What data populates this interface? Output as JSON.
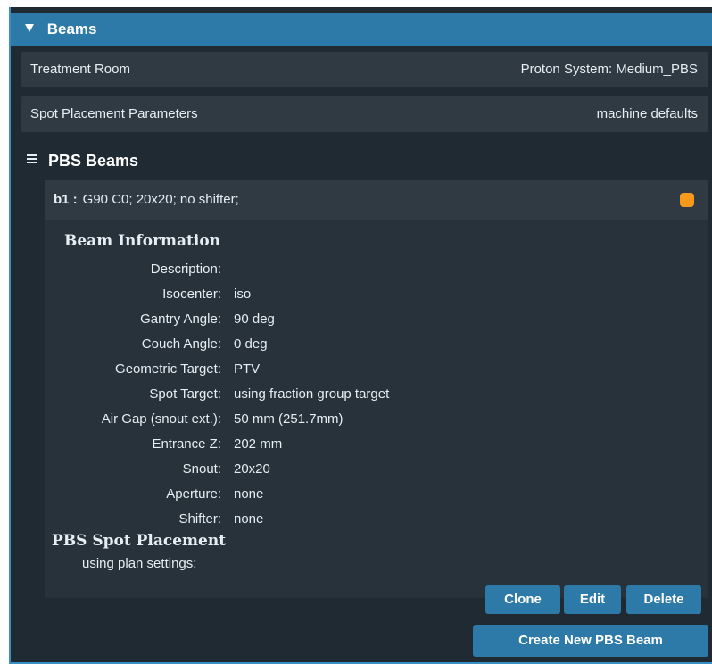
{
  "panel": {
    "title": "Beams"
  },
  "treatment_room": {
    "label": "Treatment Room",
    "value": "Proton System: Medium_PBS"
  },
  "spot_placement": {
    "label": "Spot Placement Parameters",
    "value": "machine defaults"
  },
  "pbs_section": {
    "title": "PBS Beams"
  },
  "beam": {
    "id": "b1 :",
    "summary": "G90 C0; 20x20; no shifter;",
    "status_color": "#f79a1b"
  },
  "beam_information": {
    "title": "Beam Information",
    "rows": [
      {
        "label": "Description:",
        "value": ""
      },
      {
        "label": "Isocenter:",
        "value": "iso"
      },
      {
        "label": "Gantry Angle:",
        "value": "90 deg"
      },
      {
        "label": "Couch Angle:",
        "value": "0 deg"
      },
      {
        "label": "Geometric Target:",
        "value": "PTV"
      },
      {
        "label": "Spot Target:",
        "value": "using fraction group target"
      },
      {
        "label": "Air Gap (snout ext.):",
        "value": "50 mm (251.7mm)"
      },
      {
        "label": "Entrance Z:",
        "value": "202 mm"
      },
      {
        "label": "Snout:",
        "value": "20x20"
      },
      {
        "label": "Aperture:",
        "value": "none"
      },
      {
        "label": "Shifter:",
        "value": "none"
      }
    ]
  },
  "pbs_spot_placement": {
    "title": "PBS Spot Placement",
    "setting": "using plan settings:"
  },
  "buttons": {
    "clone": "Clone",
    "edit": "Edit",
    "delete": "Delete",
    "create": "Create New PBS Beam"
  },
  "colors": {
    "header_blue": "#2d7aa9",
    "panel_bg": "#1f2a33",
    "row_bg": "#2f3a43",
    "status_orange": "#f79a1b"
  }
}
